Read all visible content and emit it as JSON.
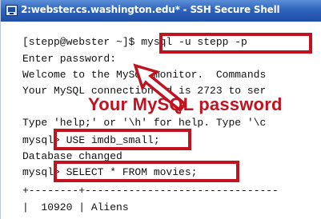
{
  "window": {
    "title": "2:webster.cs.washington.edu* - SSH Secure Shell",
    "icon": "terminal-icon"
  },
  "terminal": {
    "lines": [
      "[stepp@webster ~]$ mysql -u stepp -p",
      "Enter password:",
      "Welcome to the MySQL monitor.  Commands",
      "Your MySQL connection id is 2723 to ser",
      "",
      "Type 'help;' or '\\h' for help. Type '\\c",
      "mysql> USE imdb_small;",
      "Database changed",
      "mysql> SELECT * FROM movies;",
      "+--------+-------------------------------",
      "|  10920 | Aliens"
    ]
  },
  "annotation": {
    "text": "Your MySQL password"
  },
  "colors": {
    "highlight": "#c1121f",
    "titlebar": "#2f64bd"
  }
}
